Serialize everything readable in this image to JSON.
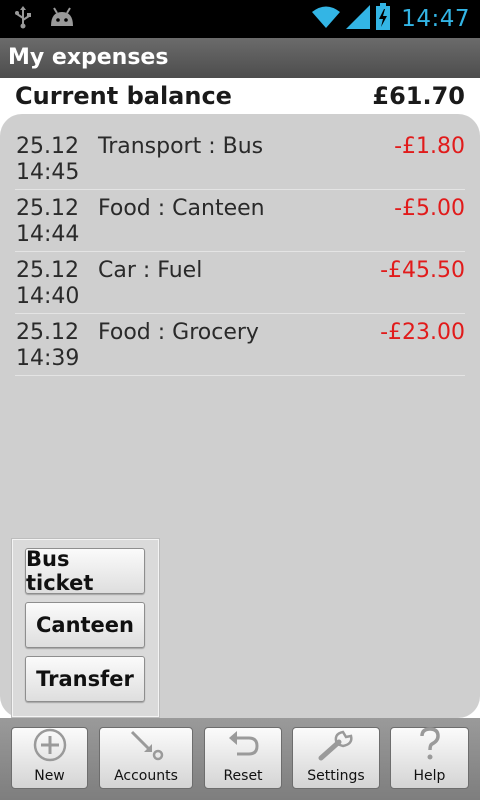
{
  "status_bar": {
    "time": "14:47",
    "icons": [
      "usb-icon",
      "android-icon",
      "wifi-icon",
      "signal-icon",
      "battery-charging-icon"
    ]
  },
  "app": {
    "title": "My expenses"
  },
  "balance": {
    "label": "Current balance",
    "value": "£61.70"
  },
  "transactions": [
    {
      "date": "25.12",
      "time": "14:45",
      "description": "Transport : Bus",
      "amount": "-£1.80"
    },
    {
      "date": "25.12",
      "time": "14:44",
      "description": "Food : Canteen",
      "amount": "-£5.00"
    },
    {
      "date": "25.12",
      "time": "14:40",
      "description": "Car : Fuel",
      "amount": "-£45.50"
    },
    {
      "date": "25.12",
      "time": "14:39",
      "description": "Food : Grocery",
      "amount": "-£23.00"
    }
  ],
  "quick_actions": [
    "Bus ticket",
    "Canteen",
    "Transfer"
  ],
  "toolbar": {
    "new_label": "New",
    "accounts_label": "Accounts",
    "reset_label": "Reset",
    "settings_label": "Settings",
    "help_label": "Help"
  },
  "colors": {
    "accent": "#33b5e5",
    "negative_amount": "#e11b1b"
  }
}
